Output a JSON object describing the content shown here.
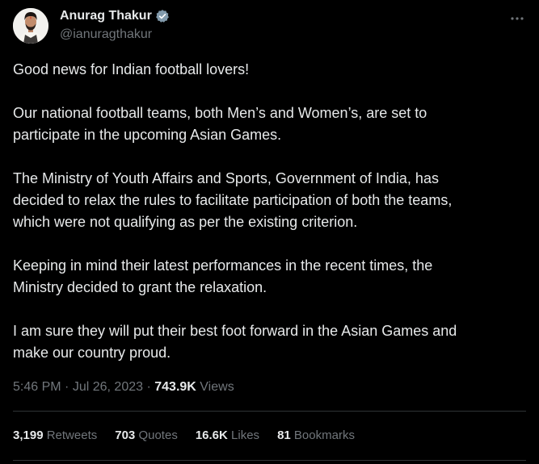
{
  "colors": {
    "background": "#000000",
    "text_primary": "#e7e9ea",
    "text_secondary": "#71767b",
    "divider": "#2f3336",
    "verified_badge": "#829aab"
  },
  "author": {
    "display_name": "Anurag Thakur",
    "handle": "@ianuragthakur",
    "verified_icon": "verified-badge-icon",
    "avatar": "profile-photo"
  },
  "more_icon": "more-horizontal-icon",
  "tweet": {
    "paragraphs": [
      [
        "Good news for Indian football lovers!"
      ],
      [
        "Our national football teams, both Men’s and Women’s, are set to",
        "participate in the upcoming Asian Games."
      ],
      [
        "The Ministry of Youth Affairs and Sports, Government of India, has",
        "decided to relax the rules to facilitate participation of both the teams,",
        "which were not qualifying as per the existing criterion."
      ],
      [
        "Keeping in mind their latest performances in the recent times, the",
        "Ministry decided to grant the relaxation."
      ],
      [
        "I am sure they will put their best foot forward in the Asian Games and",
        "make our country proud."
      ]
    ],
    "time": "5:46 PM",
    "separator": "·",
    "date": "Jul 26, 2023",
    "views_count": "743.9K",
    "views_label": "Views"
  },
  "stats": {
    "retweets_count": "3,199",
    "retweets_label": "Retweets",
    "quotes_count": "703",
    "quotes_label": "Quotes",
    "likes_count": "16.6K",
    "likes_label": "Likes",
    "bookmarks_count": "81",
    "bookmarks_label": "Bookmarks"
  }
}
